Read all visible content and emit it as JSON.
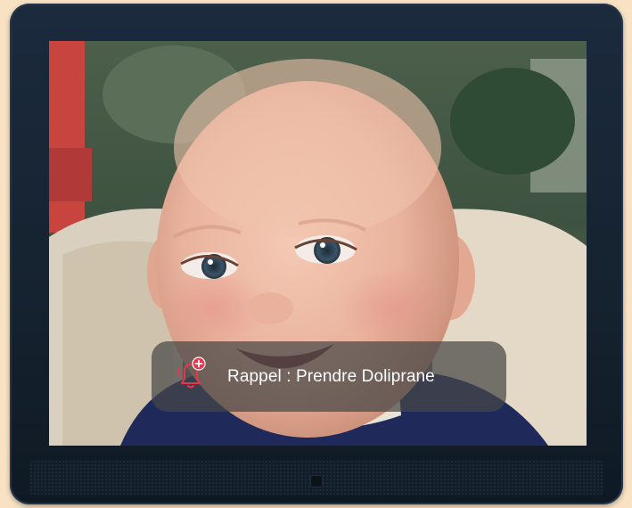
{
  "notification": {
    "text": "Rappel : Prendre Doliprane",
    "icon": "bell-plus-icon",
    "icon_color": "#e8364a"
  },
  "photo": {
    "subject": "baby-photo"
  },
  "colors": {
    "background": "#f9e2c4",
    "frame": "#17242f",
    "toast_bg": "#464646"
  }
}
